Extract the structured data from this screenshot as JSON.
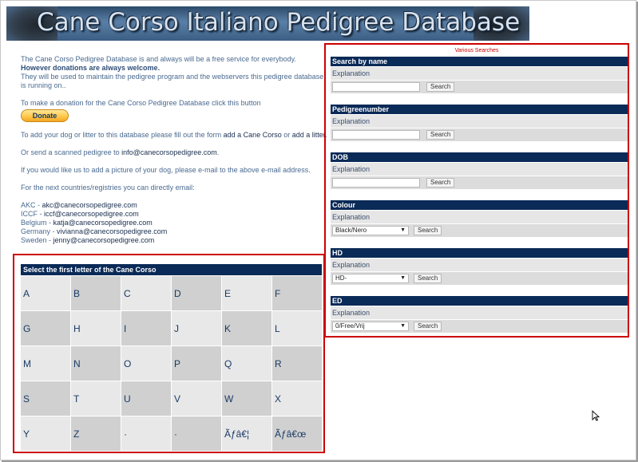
{
  "banner": {
    "title": "Cane Corso Italiano Pedigree Database"
  },
  "intro": {
    "line1": "The Cane Corso Pedigree Database is and always will be a free service for everybody.",
    "line2": "However donations are always welcome.",
    "line3": "They will be used to maintain the pedigree program and the webservers this pedigree database is running on..",
    "donate_text": "To make a donation for the Cane Corso Pedigree Database click this button",
    "donate_button": "Donate",
    "add_text_pre": "To add your dog or litter to this database please fill out the form ",
    "add_link1": "add a Cane Corso",
    "add_text_mid": " or ",
    "add_link2": "add a litter",
    "add_text_post": ".",
    "scan_pre": "Or send a scanned pedigree to ",
    "scan_email": "info@canecorsopedigree.com",
    "scan_post": ".",
    "picture_text": "If you would like us to add a picture of your dog, please e-mail to the above e-mail address.",
    "countries_text": "For the next countries/registries you can directly email:",
    "contacts": [
      {
        "label": "AKC - ",
        "email": "akc@canecorsopedigree.com"
      },
      {
        "label": "ICCF - ",
        "email": "iccf@canecorsopedigree.com"
      },
      {
        "label": "Belgium - ",
        "email": "katja@canecorsopedigree.com"
      },
      {
        "label": "Germany - ",
        "email": "vivianna@canecorsopedigree.com"
      },
      {
        "label": "Sweden - ",
        "email": "jenny@canecorsopedigree.com"
      }
    ]
  },
  "letters": {
    "header": "Select the first letter of the Cane Corso",
    "items": [
      "A",
      "B",
      "C",
      "D",
      "E",
      "F",
      "G",
      "H",
      "I",
      "J",
      "K",
      "L",
      "M",
      "N",
      "O",
      "P",
      "Q",
      "R",
      "S",
      "T",
      "U",
      "V",
      "W",
      "X",
      "Y",
      "Z",
      "·",
      "·",
      "Ãƒâ€¦",
      "Ãƒâ€œ"
    ]
  },
  "searches": {
    "caption": "Various Searches",
    "sections": [
      {
        "title": "Search by name",
        "explanation": "Explanation",
        "type": "input",
        "button": "Search"
      },
      {
        "title": "Pedigreenumber",
        "explanation": "Explanation",
        "type": "input",
        "button": "Search"
      },
      {
        "title": "DOB",
        "explanation": "Explanation",
        "type": "input",
        "button": "Search"
      },
      {
        "title": "Colour",
        "explanation": "Explanation",
        "type": "select",
        "value": "Black/Nero",
        "button": "Search"
      },
      {
        "title": "HD",
        "explanation": "Explanation",
        "type": "select",
        "value": "HD-",
        "button": "Search"
      },
      {
        "title": "ED",
        "explanation": "Explanation",
        "type": "select",
        "value": "0/Free/Vrij",
        "button": "Search"
      }
    ]
  },
  "colors": {
    "header_navy": "#0a2a57",
    "panel_border": "#cc0000",
    "text_blue": "#4a6a90"
  }
}
